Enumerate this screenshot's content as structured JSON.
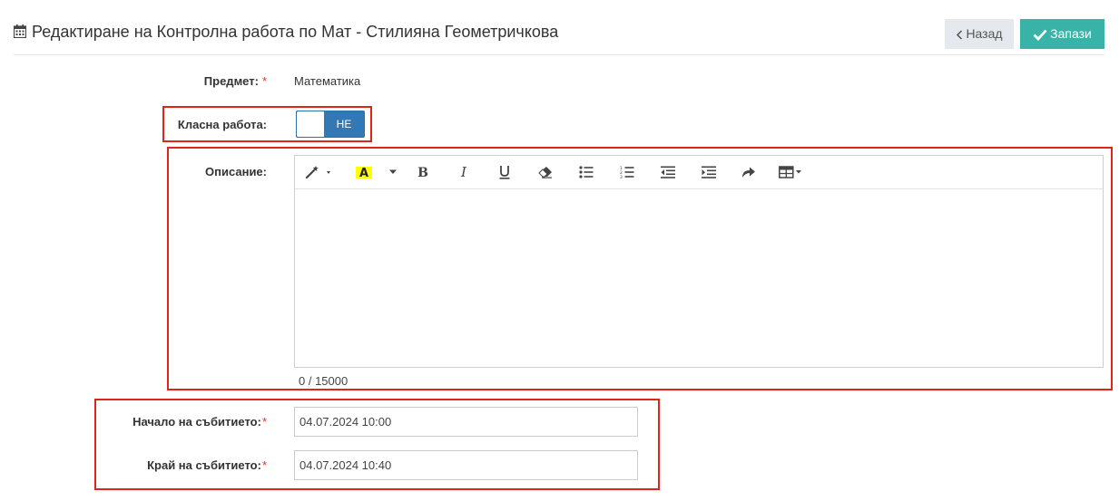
{
  "header": {
    "title": "Редактиране на Контролна работа по Мат - Стилияна Геометричкова",
    "back_label": "Назад",
    "save_label": "Запази"
  },
  "form": {
    "subject_label": "Предмет:",
    "subject_value": "Математика",
    "classwork_label": "Класна работа:",
    "classwork_toggle": "НЕ",
    "description_label": "Описание:",
    "description_counter": "0 / 15000",
    "start_label": "Начало на събитието:",
    "start_value": "04.07.2024 10:00",
    "end_label": "Край на събитието:",
    "end_value": "04.07.2024 10:40",
    "required_mark": "*"
  },
  "editor_toolbar": [
    "magic-icon",
    "font-color-icon",
    "bold-icon",
    "italic-icon",
    "underline-icon",
    "eraser-icon",
    "unordered-list-icon",
    "ordered-list-icon",
    "outdent-icon",
    "indent-icon",
    "redo-icon",
    "table-icon"
  ],
  "colors": {
    "save": "#39b3a7",
    "back": "#e5e8ec",
    "toggle": "#3178b5",
    "highlight": "#e02418",
    "required": "#d9352b",
    "highlight_text_bg": "#ffff00"
  }
}
